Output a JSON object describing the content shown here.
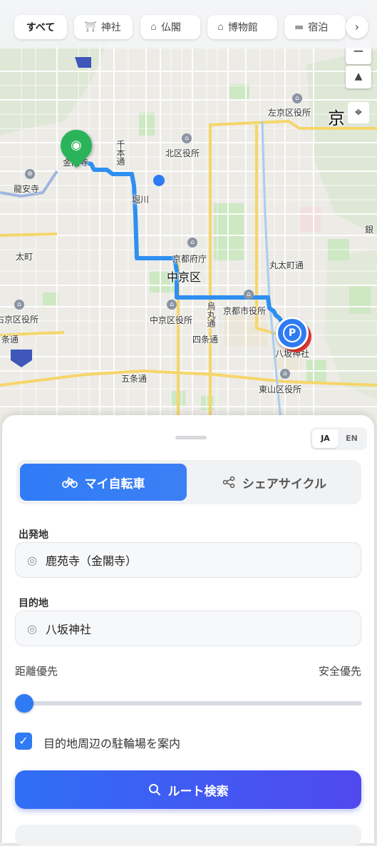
{
  "categories": [
    {
      "label": "すべて",
      "icon": "all-icon",
      "active": true
    },
    {
      "label": "神社",
      "icon": "shrine-icon"
    },
    {
      "label": "仏閣",
      "icon": "temple-icon"
    },
    {
      "label": "博物館",
      "icon": "museum-icon"
    },
    {
      "label": "宿泊",
      "icon": "bed-icon"
    }
  ],
  "map": {
    "labels": {
      "kinkakuji": "金閣寺",
      "ryoanji": "龍安寺",
      "kita_ward": "北区役所",
      "sakyo_ward": "左京区役所",
      "kyo_big": "京",
      "horikawa": "堀川",
      "prefecture": "京都府庁",
      "nakagyo": "中京区",
      "nakagyo_office": "中京区役所",
      "city_hall": "京都市役所",
      "marutamachi": "丸太町通",
      "shijo": "四条通",
      "gojo": "五条通",
      "yasaka": "八坂神社",
      "higashiyama": "東山区役所",
      "ukyo": "右京区役所",
      "shijo_left": "条通",
      "uzumasa": "太町",
      "senbon": "千本通",
      "karasuma": "烏丸通",
      "gin": "銀"
    },
    "end_marker_letter": "P"
  },
  "sheet": {
    "lang": {
      "ja": "JA",
      "en": "EN",
      "selected": "JA"
    },
    "tabs": [
      {
        "label": "マイ自転車",
        "icon": "bicycle-icon",
        "active": true
      },
      {
        "label": "シェアサイクル",
        "icon": "share-icon",
        "active": false
      }
    ],
    "origin": {
      "label": "出発地",
      "value": "鹿苑寺（金閣寺）"
    },
    "destination": {
      "label": "目的地",
      "value": "八坂神社"
    },
    "preference": {
      "left": "距離優先",
      "right": "安全優先",
      "value": 0
    },
    "parking_option": {
      "label": "目的地周辺の駐輪場を案内",
      "checked": true
    },
    "search_button": "ルート検索"
  },
  "colors": {
    "accent": "#2e7bf3",
    "start": "#29b45a",
    "route": "#2e8ff0"
  }
}
